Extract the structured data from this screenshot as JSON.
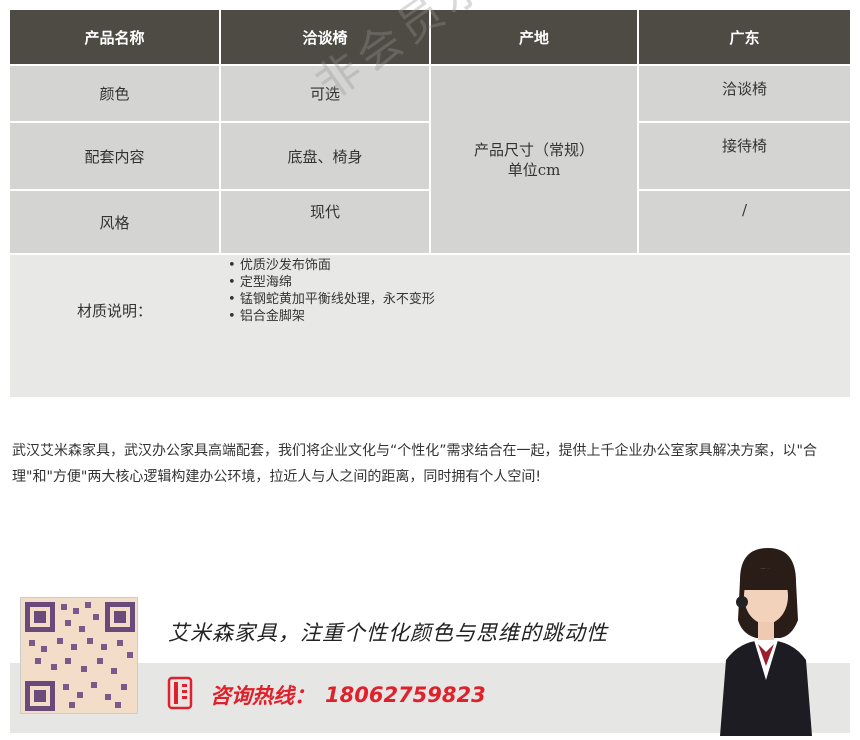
{
  "table": {
    "header": [
      "产品名称",
      "洽谈椅",
      "产地",
      "广东"
    ],
    "rows": [
      {
        "label": "颜色",
        "value": "可选",
        "size_value": "洽谈椅"
      },
      {
        "label": "配套内容",
        "value": "底盘、椅身",
        "size_value": "接待椅"
      },
      {
        "label": "风格",
        "value": "现代",
        "size_value": "/"
      }
    ],
    "size_label_line1": "产品尺寸（常规）",
    "size_label_line2": "单位cm",
    "material_label": "材质说明：",
    "material_items": [
      "优质沙发布饰面",
      "定型海绵",
      "锰钢蛇黄加平衡线处理，永不变形",
      "铝合金脚架"
    ]
  },
  "watermark": "非会员水印",
  "description": "武汉艾米森家具，武汉办公家具高端配套，我们将企业文化与“个性化”需求结合在一起，提供上千企业办公室家具解决方案，以\"合理\"和\"方便\"两大核心逻辑构建办公环境，拉近人与人之间的距离，同时拥有个人空间!",
  "banner": {
    "slogan": "艾米森家具，注重个性化颜色与思维的跳动性",
    "hotline_label": "咨询热线：",
    "hotline_number": "18062759823"
  },
  "colors": {
    "header_bg": "#4e4a44",
    "cell_bg": "#d4d4d2",
    "accent_red": "#e0202a"
  }
}
